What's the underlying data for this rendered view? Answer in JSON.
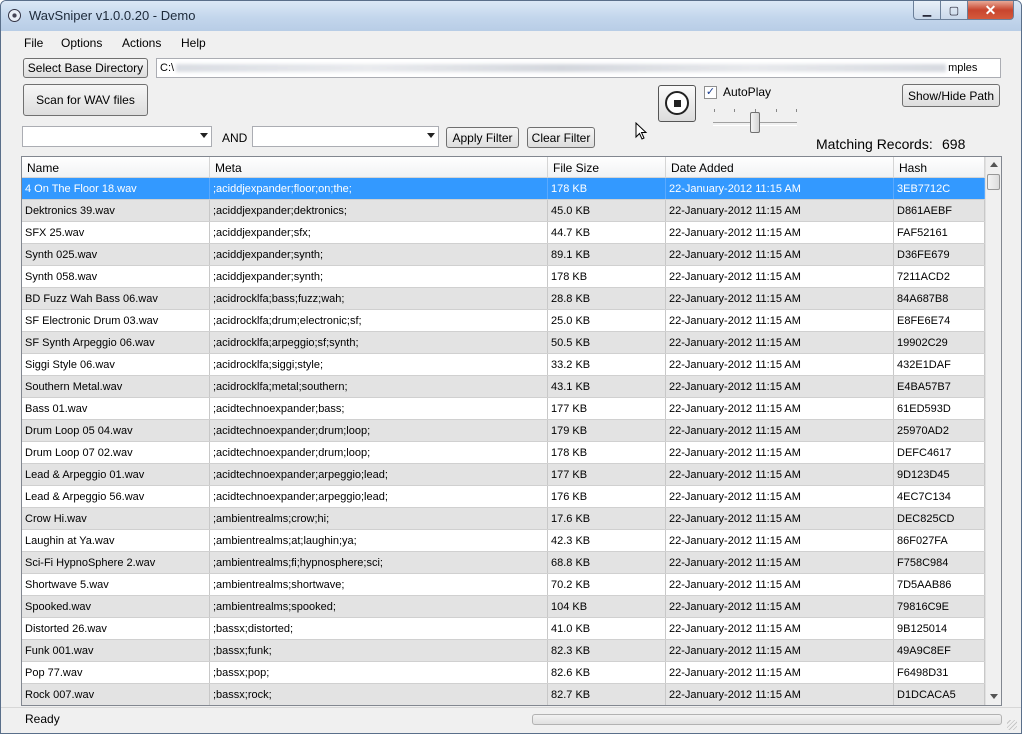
{
  "window": {
    "title": "WavSniper v1.0.0.20 - Demo",
    "minimize": "▁",
    "maximize": "▢",
    "close": "✕"
  },
  "menu": [
    "File",
    "Options",
    "Actions",
    "Help"
  ],
  "toolbar": {
    "select_base_label": "Select Base Directory",
    "path_prefix": "C:\\",
    "path_suffix": "mples",
    "scan_label": "Scan for WAV files",
    "and_label": "AND",
    "apply_filter_label": "Apply Filter",
    "clear_filter_label": "Clear Filter",
    "autoplay_label": "AutoPlay",
    "autoplay_checked": "✓",
    "show_hide_label": "Show/Hide Path",
    "matching_label": "Matching Records:",
    "matching_value": "698",
    "volume_level": 0.5
  },
  "grid": {
    "columns": [
      "Name",
      "Meta",
      "File Size",
      "Date Added",
      "Hash"
    ],
    "selected_index": 0,
    "rows": [
      [
        "4 On The Floor 18.wav",
        ";aciddjexpander;floor;on;the;",
        "178 KB",
        "22-January-2012 11:15 AM",
        "3EB7712C"
      ],
      [
        "Dektronics 39.wav",
        ";aciddjexpander;dektronics;",
        "45.0 KB",
        "22-January-2012 11:15 AM",
        "D861AEBF"
      ],
      [
        "SFX  25.wav",
        ";aciddjexpander;sfx;",
        "44.7 KB",
        "22-January-2012 11:15 AM",
        "FAF52161"
      ],
      [
        "Synth 025.wav",
        ";aciddjexpander;synth;",
        "89.1 KB",
        "22-January-2012 11:15 AM",
        "D36FE679"
      ],
      [
        "Synth 058.wav",
        ";aciddjexpander;synth;",
        "178 KB",
        "22-January-2012 11:15 AM",
        "7211ACD2"
      ],
      [
        "BD Fuzz Wah Bass 06.wav",
        ";acidrocklfa;bass;fuzz;wah;",
        "28.8 KB",
        "22-January-2012 11:15 AM",
        "84A687B8"
      ],
      [
        "SF Electronic Drum 03.wav",
        ";acidrocklfa;drum;electronic;sf;",
        "25.0 KB",
        "22-January-2012 11:15 AM",
        "E8FE6E74"
      ],
      [
        "SF Synth Arpeggio 06.wav",
        ";acidrocklfa;arpeggio;sf;synth;",
        "50.5 KB",
        "22-January-2012 11:15 AM",
        "19902C29"
      ],
      [
        "Siggi Style 06.wav",
        ";acidrocklfa;siggi;style;",
        "33.2 KB",
        "22-January-2012 11:15 AM",
        "432E1DAF"
      ],
      [
        "Southern Metal.wav",
        ";acidrocklfa;metal;southern;",
        "43.1 KB",
        "22-January-2012 11:15 AM",
        "E4BA57B7"
      ],
      [
        "Bass 01.wav",
        ";acidtechnoexpander;bass;",
        "177 KB",
        "22-January-2012 11:15 AM",
        "61ED593D"
      ],
      [
        "Drum Loop 05 04.wav",
        ";acidtechnoexpander;drum;loop;",
        "179 KB",
        "22-January-2012 11:15 AM",
        "25970AD2"
      ],
      [
        "Drum Loop 07 02.wav",
        ";acidtechnoexpander;drum;loop;",
        "178 KB",
        "22-January-2012 11:15 AM",
        "DEFC4617"
      ],
      [
        "Lead & Arpeggio 01.wav",
        ";acidtechnoexpander;arpeggio;lead;",
        "177 KB",
        "22-January-2012 11:15 AM",
        "9D123D45"
      ],
      [
        "Lead & Arpeggio 56.wav",
        ";acidtechnoexpander;arpeggio;lead;",
        "176 KB",
        "22-January-2012 11:15 AM",
        "4EC7C134"
      ],
      [
        "Crow Hi.wav",
        ";ambientrealms;crow;hi;",
        "17.6 KB",
        "22-January-2012 11:15 AM",
        "DEC825CD"
      ],
      [
        "Laughin at Ya.wav",
        ";ambientrealms;at;laughin;ya;",
        "42.3 KB",
        "22-January-2012 11:15 AM",
        "86F027FA"
      ],
      [
        "Sci-Fi HypnoSphere 2.wav",
        ";ambientrealms;fi;hypnosphere;sci;",
        "68.8 KB",
        "22-January-2012 11:15 AM",
        "F758C984"
      ],
      [
        "Shortwave 5.wav",
        ";ambientrealms;shortwave;",
        "70.2 KB",
        "22-January-2012 11:15 AM",
        "7D5AAB86"
      ],
      [
        "Spooked.wav",
        ";ambientrealms;spooked;",
        "104 KB",
        "22-January-2012 11:15 AM",
        "79816C9E"
      ],
      [
        "Distorted 26.wav",
        ";bassx;distorted;",
        "41.0 KB",
        "22-January-2012 11:15 AM",
        "9B125014"
      ],
      [
        "Funk 001.wav",
        ";bassx;funk;",
        "82.3 KB",
        "22-January-2012 11:15 AM",
        "49A9C8EF"
      ],
      [
        "Pop 77.wav",
        ";bassx;pop;",
        "82.6 KB",
        "22-January-2012 11:15 AM",
        "F6498D31"
      ],
      [
        "Rock 007.wav",
        ";bassx;rock;",
        "82.7 KB",
        "22-January-2012 11:15 AM",
        "D1DCACA5"
      ]
    ]
  },
  "status": {
    "text": "Ready",
    "progress": 0
  },
  "colors": {
    "selection": "#3399ff",
    "alt_row": "#e3e3e3"
  }
}
